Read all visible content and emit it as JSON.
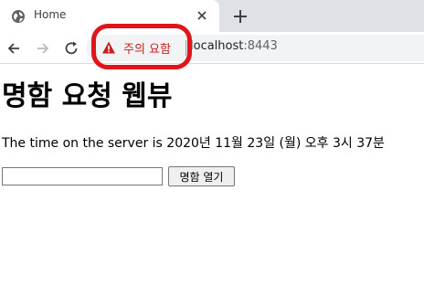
{
  "browser": {
    "tab": {
      "title": "Home",
      "favicon": "globe-icon",
      "close_icon": "close-icon"
    },
    "new_tab_icon": "plus-icon",
    "toolbar": {
      "back_icon": "arrow-left-icon",
      "forward_icon": "arrow-right-icon",
      "reload_icon": "reload-icon",
      "security_warning": "주의 요함",
      "warning_icon": "warning-triangle-icon",
      "url_host": "localhost",
      "url_port": ":8443"
    },
    "colors": {
      "warning": "#c5221f",
      "highlight_ring": "#e0141b"
    }
  },
  "page": {
    "heading": "명함 요청 웹뷰",
    "server_time_text": "The time on the server is 2020년 11월 23일 (월) 오후 3시 37분",
    "input_value": "",
    "submit_label": "명함 열기"
  }
}
